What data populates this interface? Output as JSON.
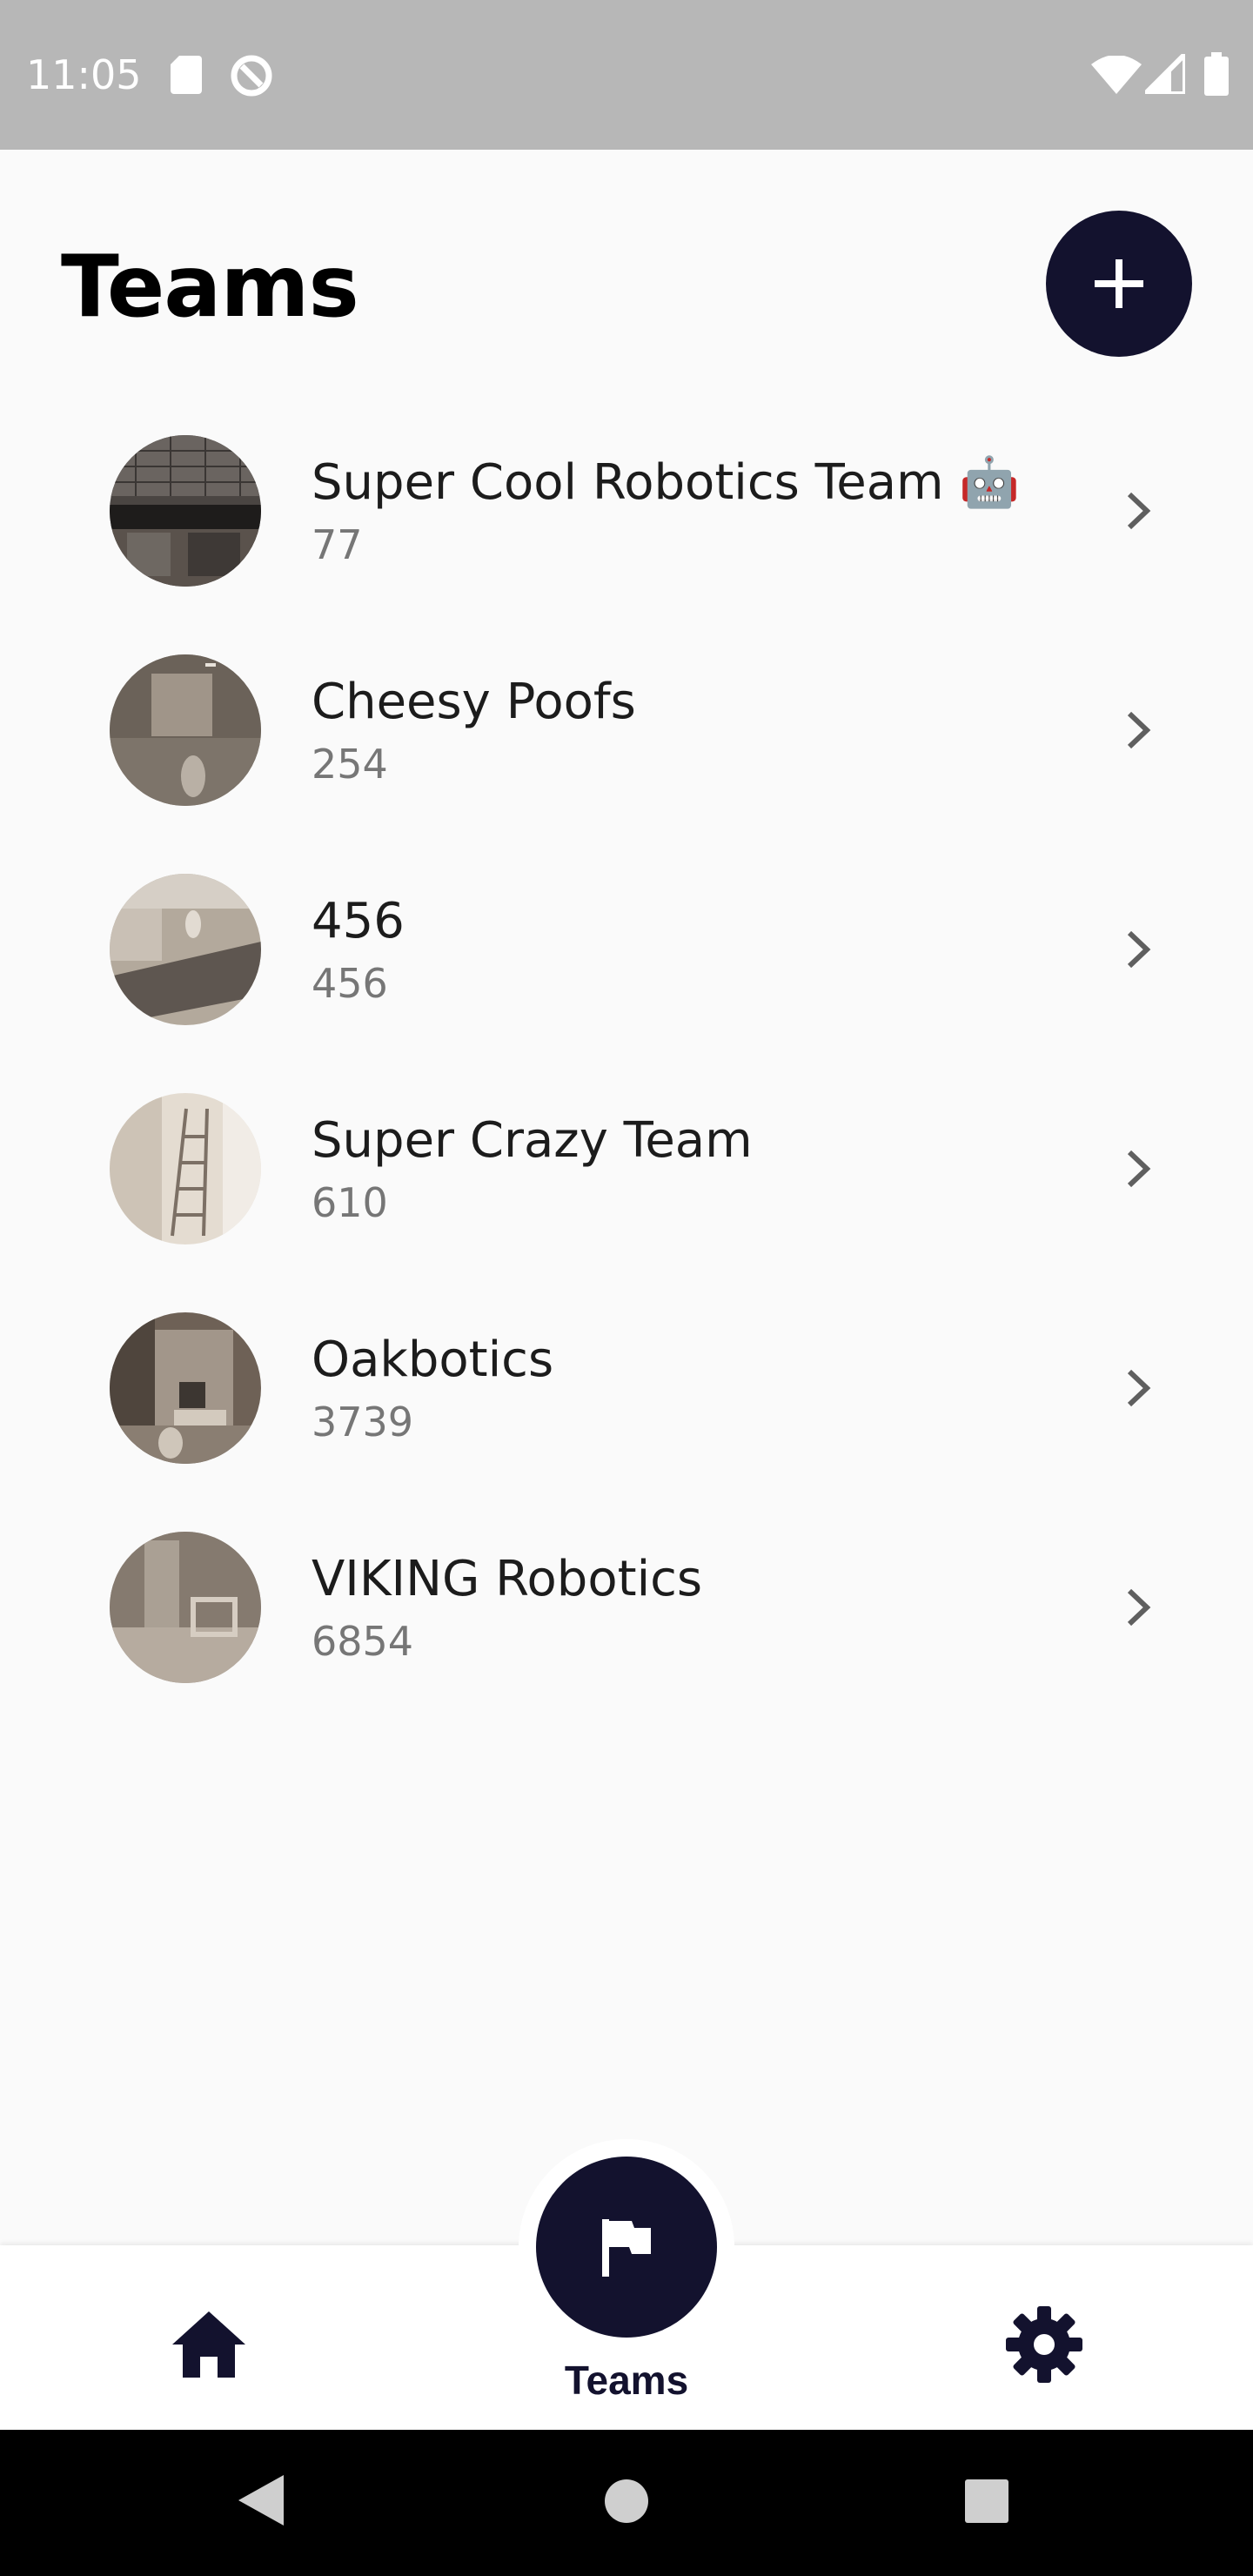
{
  "status_bar": {
    "time": "11:05",
    "left_icons": [
      "sd-card-icon",
      "data-saver-icon"
    ],
    "right_icons": [
      "wifi-icon",
      "signal-icon",
      "battery-icon"
    ]
  },
  "header": {
    "title": "Teams",
    "add_button_icon": "plus-icon"
  },
  "teams": [
    {
      "name": "Super Cool Robotics Team 🤖",
      "number": "77"
    },
    {
      "name": "Cheesy Poofs",
      "number": "254"
    },
    {
      "name": "456",
      "number": "456"
    },
    {
      "name": "Super Crazy Team",
      "number": "610"
    },
    {
      "name": "Oakbotics",
      "number": "3739"
    },
    {
      "name": "VIKING Robotics",
      "number": "6854"
    }
  ],
  "bottom_nav": {
    "home_icon": "home-icon",
    "teams_icon": "flag-icon",
    "teams_label": "Teams",
    "settings_icon": "gear-icon"
  },
  "system_nav": {
    "icons": [
      "back-icon",
      "home-circle-icon",
      "recents-icon"
    ]
  },
  "colors": {
    "accent": "#13122e",
    "background": "#fafafa",
    "status_bar": "#b7b7b7"
  }
}
